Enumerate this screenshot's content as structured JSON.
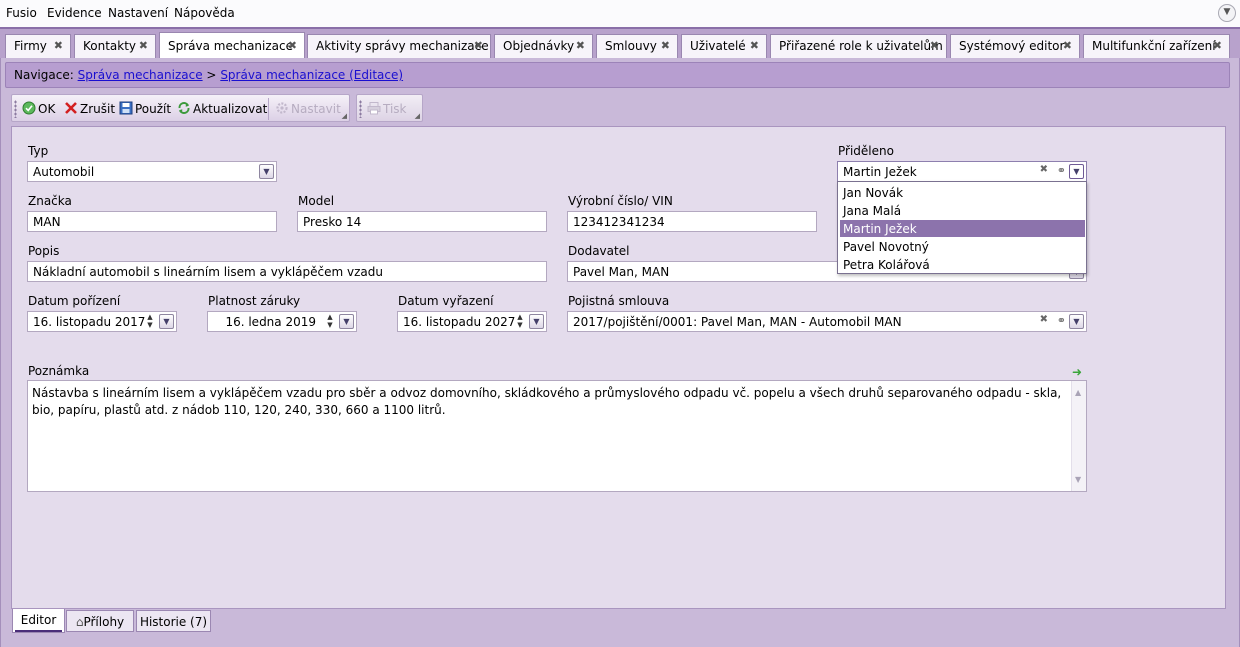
{
  "menu": {
    "items": [
      "Fusio",
      "Evidence",
      "Nastavení",
      "Nápověda"
    ]
  },
  "tabs": [
    {
      "label": "Firmy"
    },
    {
      "label": "Kontakty"
    },
    {
      "label": "Správa mechanizace",
      "active": true
    },
    {
      "label": "Aktivity správy mechanizace"
    },
    {
      "label": "Objednávky"
    },
    {
      "label": "Smlouvy"
    },
    {
      "label": "Uživatelé"
    },
    {
      "label": "Přiřazené role k uživatelům"
    },
    {
      "label": "Systémový editor"
    },
    {
      "label": "Multifunkční zařízení"
    }
  ],
  "navigation": {
    "prefix": "Navigace:",
    "crumb1": "Správa mechanizace",
    "separator": ">",
    "crumb2": "Správa mechanizace (Editace)"
  },
  "toolbar": {
    "ok": "OK",
    "cancel": "Zrušit",
    "apply": "Použít",
    "refresh": "Aktualizovat",
    "settings": "Nastavit",
    "print": "Tisk"
  },
  "form": {
    "typ": {
      "label": "Typ",
      "value": "Automobil"
    },
    "prideleno": {
      "label": "Přiděleno",
      "value": "Martin Ježek"
    },
    "znacka": {
      "label": "Značka",
      "value": "MAN"
    },
    "model": {
      "label": "Model",
      "value": "Presko 14"
    },
    "vin": {
      "label": "Výrobní číslo/ VIN",
      "value": "123412341234"
    },
    "popis": {
      "label": "Popis",
      "value": "Nákladní automobil s lineárním lisem a vyklápěčem vzadu"
    },
    "dodavatel": {
      "label": "Dodavatel",
      "value": "Pavel Man, MAN"
    },
    "datum_porizeni": {
      "label": "Datum pořízení",
      "value": "16. listopadu 2017"
    },
    "platnost_zaruky": {
      "label": "Platnost záruky",
      "value": "16. ledna 2019"
    },
    "datum_vyrazeni": {
      "label": "Datum vyřazení",
      "value": "16. listopadu 2027"
    },
    "pojistna_smlouva": {
      "label": "Pojistná smlouva",
      "value": "2017/pojištění/0001: Pavel Man, MAN - Automobil MAN"
    },
    "poznamka": {
      "label": "Poznámka",
      "value": "Nástavba s lineárním lisem a vyklápěčem vzadu pro sběr a odvoz domovního, skládkového a průmyslového odpadu vč. popelu a všech druhů separovaného odpadu - skla, bio, papíru, plastů atd. z nádob 110, 120, 240, 330, 660 a 1100 litrů."
    }
  },
  "dropdown_options": [
    "Jan Novák",
    "Jana Malá",
    "Martin Ježek",
    "Pavel Novotný",
    "Petra Kolářová"
  ],
  "bottom_tabs": {
    "editor": "Editor",
    "attachments": "Přílohy",
    "history": "Historie (7)"
  },
  "colors": {
    "accent": "#b8a2cc",
    "selected_option": "#8c73ac",
    "link": "#1a0fd0"
  }
}
